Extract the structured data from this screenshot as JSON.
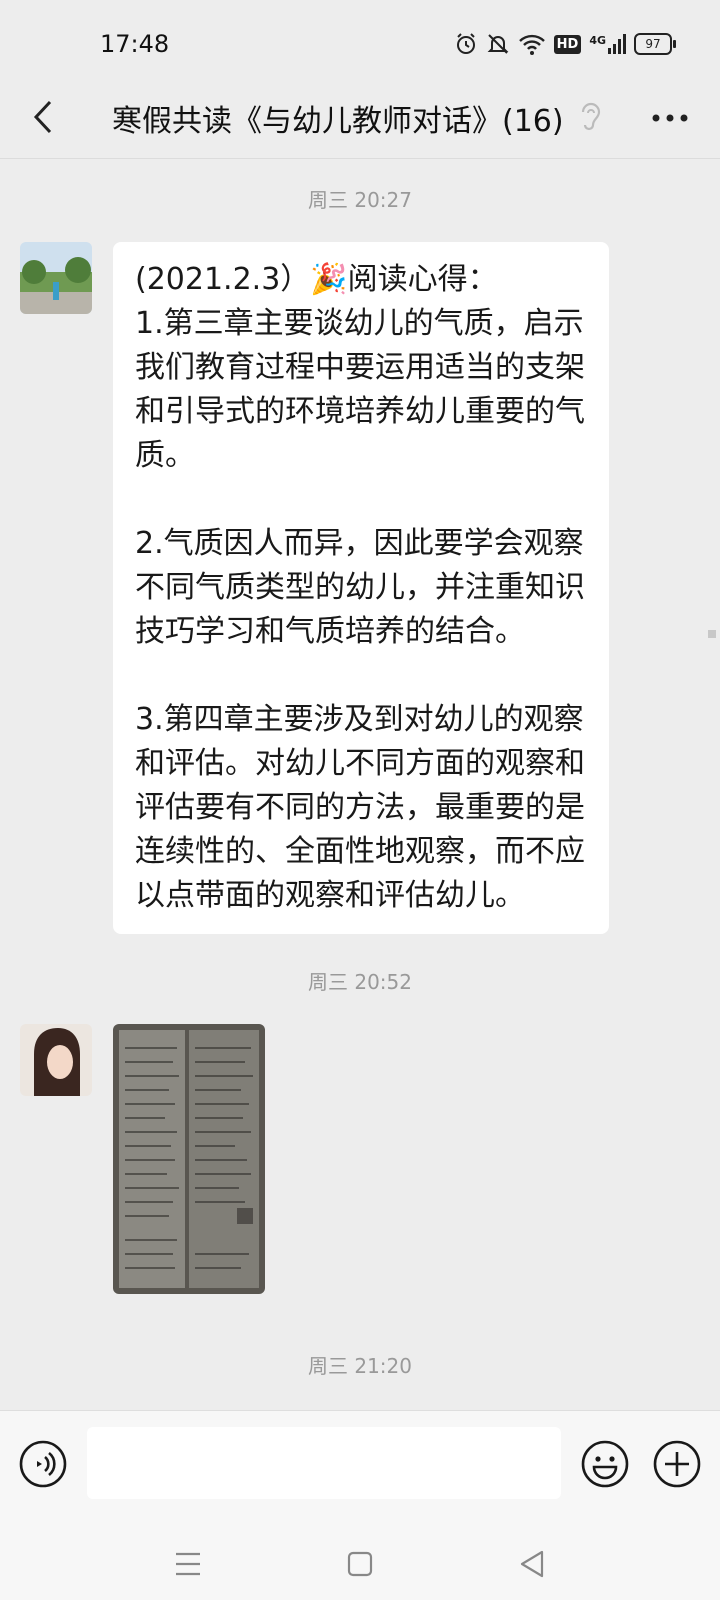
{
  "status_bar": {
    "time": "17:48",
    "network": "4G",
    "hd": "HD",
    "battery": "97"
  },
  "nav": {
    "title": "寒假共读《与幼儿教师对话》(16)"
  },
  "chat": {
    "timestamps": [
      "周三 20:27",
      "周三 20:52",
      "周三 21:20"
    ],
    "message1": {
      "paragraphs": [
        "(2021.2.3）🎉阅读心得：\n1.第三章主要谈幼儿的气质，启示我们教育过程中要运用适当的支架和引导式的环境培养幼儿重要的气质。",
        "2.气质因人而异，因此要学会观察不同气质类型的幼儿，并注重知识技巧学习和气质培养的结合。",
        "3.第四章主要涉及到对幼儿的观察和评估。对幼儿不同方面的观察和评估要有不同的方法，最重要的是连续性的、全面性地观察，而不应以点带面的观察和评估幼儿。"
      ]
    }
  },
  "input": {
    "value": "",
    "placeholder": ""
  },
  "colors": {
    "background": "#ededed",
    "bubble": "#ffffff",
    "timestamp": "#999999"
  }
}
